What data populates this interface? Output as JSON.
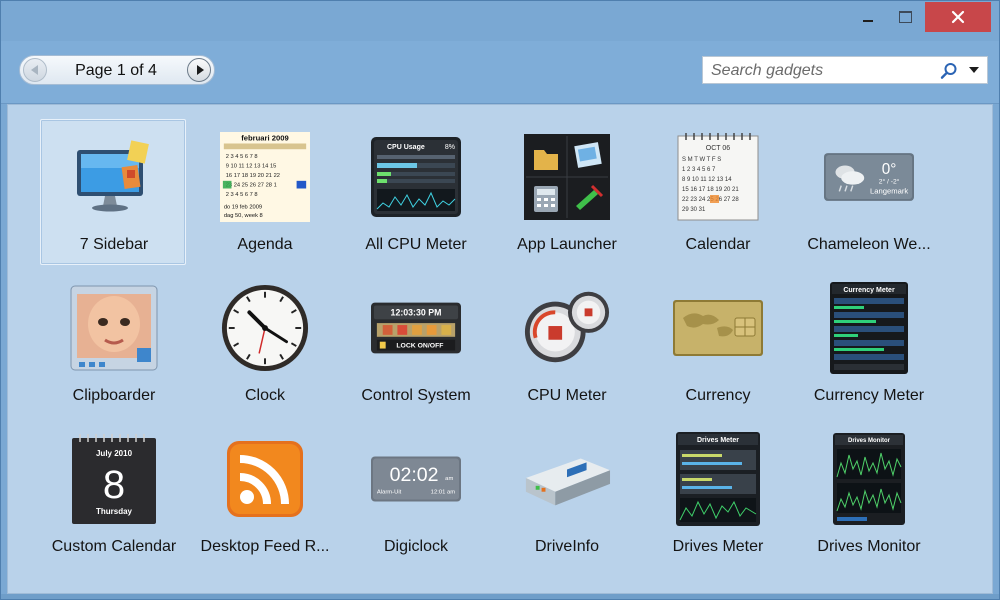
{
  "window": {
    "controls": {
      "minimize": "–",
      "maximize": "□",
      "close": "✕"
    }
  },
  "toolbar": {
    "pager_text": "Page 1 of 4",
    "search_placeholder": "Search gadgets",
    "prev_icon": "chevron-left-icon",
    "next_icon": "chevron-right-icon"
  },
  "thumb_text": {
    "agenda_month": "februari 2009",
    "agenda_foot1": "do 19 feb 2009",
    "agenda_foot2": "dag 50, week 8",
    "cpu_title": "CPU Usage",
    "cpu_pct": "8%",
    "calendar_month": "OCT 06",
    "weather_temp": "0°",
    "weather_range": "2° / -2°",
    "weather_city": "Langemark",
    "control_time": "12:03:30 PM",
    "control_lock": "LOCK ON/OFF",
    "currency_title": "Currency Meter",
    "custom_cal_month": "July 2010",
    "custom_cal_day": "8",
    "custom_cal_weekday": "Thursday",
    "digiclock_time": "02:02",
    "digiclock_ampm": "am",
    "digiclock_alarm": "Alarm-Uit",
    "digiclock_alarm_time": "12:01 am",
    "drives_meter_title": "Drives Meter",
    "drives_monitor_title": "Drives Monitor"
  },
  "gadgets": [
    {
      "label": "7 Sidebar",
      "icon": "monitor-sidebar-icon",
      "selected": true
    },
    {
      "label": "Agenda",
      "icon": "agenda-calendar-icon"
    },
    {
      "label": "All CPU Meter",
      "icon": "cpu-usage-icon"
    },
    {
      "label": "App Launcher",
      "icon": "app-launcher-icon"
    },
    {
      "label": "Calendar",
      "icon": "calendar-icon"
    },
    {
      "label": "Chameleon We...",
      "icon": "weather-icon"
    },
    {
      "label": "Clipboarder",
      "icon": "clipboard-photo-icon"
    },
    {
      "label": "Clock",
      "icon": "clock-icon"
    },
    {
      "label": "Control System",
      "icon": "control-system-icon"
    },
    {
      "label": "CPU Meter",
      "icon": "cpu-gauge-icon"
    },
    {
      "label": "Currency",
      "icon": "currency-card-icon"
    },
    {
      "label": "Currency Meter",
      "icon": "currency-meter-icon"
    },
    {
      "label": "Custom Calendar",
      "icon": "custom-calendar-icon"
    },
    {
      "label": "Desktop Feed R...",
      "icon": "rss-feed-icon"
    },
    {
      "label": "Digiclock",
      "icon": "digital-clock-icon"
    },
    {
      "label": "DriveInfo",
      "icon": "hard-drive-icon"
    },
    {
      "label": "Drives Meter",
      "icon": "drives-meter-icon"
    },
    {
      "label": "Drives Monitor",
      "icon": "drives-monitor-icon"
    }
  ]
}
